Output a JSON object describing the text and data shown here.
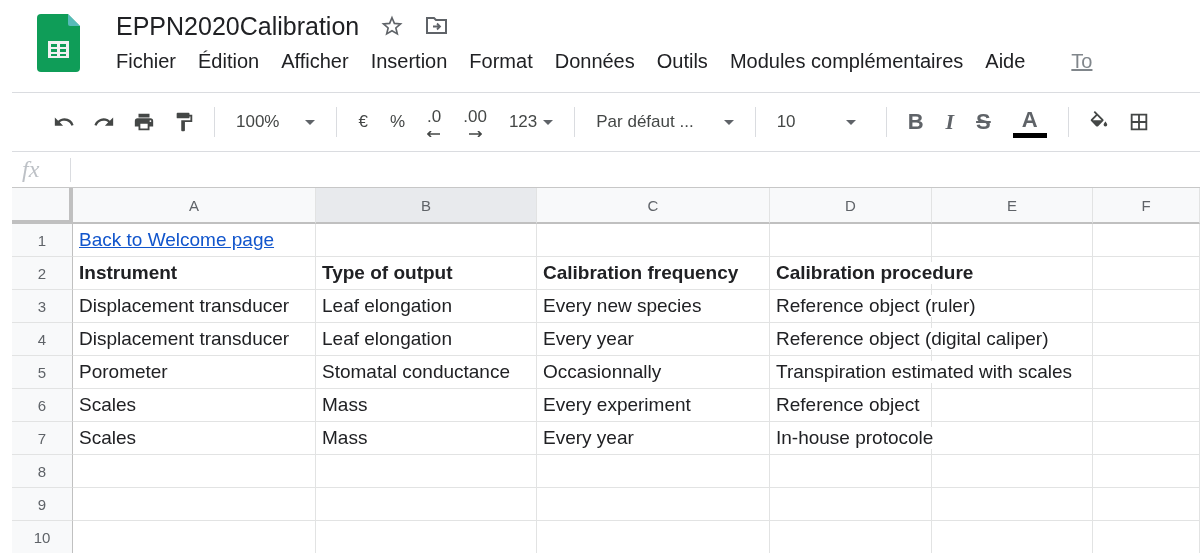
{
  "document": {
    "title": "EPPN2020Calibration"
  },
  "menu": [
    "Fichier",
    "Édition",
    "Afficher",
    "Insertion",
    "Format",
    "Données",
    "Outils",
    "Modules complémentaires",
    "Aide"
  ],
  "save_status": "To",
  "toolbar": {
    "zoom": "100%",
    "currency": "€",
    "percent": "%",
    "decrease_decimals": ".0",
    "increase_decimals": ".00",
    "number_format": "123",
    "font": "Par défaut ...",
    "font_size": "10",
    "bold": "B",
    "italic": "I",
    "strikethrough": "S",
    "text_color": "A"
  },
  "formula_bar": {
    "label": "fx"
  },
  "columns": [
    {
      "label": "A",
      "selected": false
    },
    {
      "label": "B",
      "selected": true
    },
    {
      "label": "C",
      "selected": false
    },
    {
      "label": "D",
      "selected": false
    },
    {
      "label": "E",
      "selected": false
    },
    {
      "label": "F",
      "selected": false
    }
  ],
  "rows": [
    {
      "number": "1",
      "kind": "link",
      "cells": [
        "Back to Welcome page"
      ]
    },
    {
      "number": "2",
      "kind": "bold",
      "cells": [
        "Instrument",
        "Type of output",
        "Calibration frequency",
        "Calibration procedure"
      ]
    },
    {
      "number": "3",
      "kind": "plain",
      "cells": [
        "Displacement transducer",
        "Leaf elongation",
        "Every new species",
        "Reference object (ruler)"
      ]
    },
    {
      "number": "4",
      "kind": "plain",
      "cells": [
        "Displacement transducer",
        "Leaf elongation",
        "Every year",
        "Reference object (digital caliper)"
      ]
    },
    {
      "number": "5",
      "kind": "plain",
      "cells": [
        "Porometer",
        "Stomatal conductance",
        "Occasionnally",
        "Transpiration estimated with scales"
      ]
    },
    {
      "number": "6",
      "kind": "plain",
      "cells": [
        "Scales",
        "Mass",
        "Every experiment",
        "Reference object"
      ]
    },
    {
      "number": "7",
      "kind": "plain",
      "cells": [
        "Scales",
        "Mass",
        "Every year",
        "In-house protocole"
      ]
    },
    {
      "number": "8",
      "kind": "plain",
      "cells": []
    },
    {
      "number": "9",
      "kind": "plain",
      "cells": []
    },
    {
      "number": "10",
      "kind": "plain",
      "cells": []
    }
  ]
}
